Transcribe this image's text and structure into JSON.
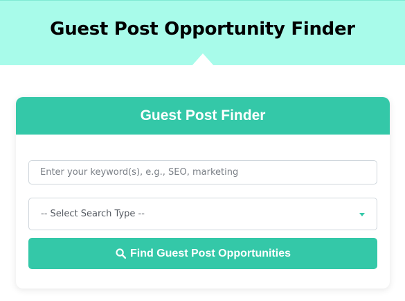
{
  "header": {
    "title": "Guest Post Opportunity Finder"
  },
  "finder": {
    "title": "Guest Post Finder",
    "keyword_input": {
      "value": "",
      "placeholder": "Enter your keyword(s), e.g., SEO, marketing"
    },
    "search_type": {
      "selected": "-- Select Search Type --"
    },
    "submit_label": "Find Guest Post Opportunities",
    "submit_icon": "search-icon"
  },
  "colors": {
    "hero_bg": "#a8fbea",
    "accent": "#34c8a8",
    "text": "#000000"
  }
}
